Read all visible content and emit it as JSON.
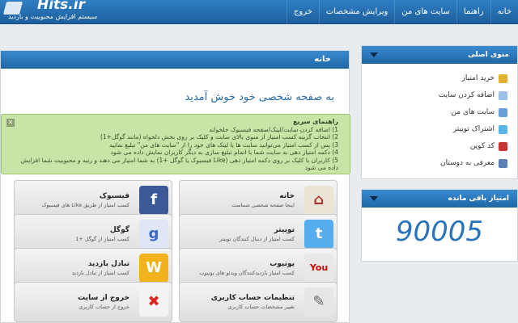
{
  "brand": {
    "logo_text": "Hits.ir",
    "tagline": "سیستم افزایش محبوبیت و بازدید"
  },
  "topnav": [
    "خانه",
    "راهنما",
    "سایت های من",
    "ویرایش مشخصات",
    "خروج"
  ],
  "main": {
    "header": "خانه",
    "welcome": "به صفحه شخصی خود خوش آمدید",
    "quick_guide": {
      "title": "راهنمای سریع",
      "lines": [
        "1) اضافه کردن سایت/لینک/صفحه فیسبوک خلخوانه",
        "2) انتخاب گزینه کسب امتیاز از منوی بالای سایت و کلیک بر روی بخش دلخواه (مانند گوگل+1)",
        "3) پس از کسب امتیاز می‌توانید سایت ها یا لینک های خود را از \"سایت های من\" تبلیغ نمایید",
        "4) دکمه امتیاز دهی به سایت شما با اتمام تبلیغ سازی به دیگر کاربران نمایش داده می شود",
        "5) کاربران با کلیک بر روی دکمه امتیاز دهی (Like فیسبوک یا گوگل +1) به شما امتیاز می دهند و رتبه و محبوبیت شما افزایش داده می شود"
      ]
    },
    "tiles": [
      {
        "title": "خانه",
        "subtitle": "اینجا صفحه شخصی شماست",
        "icon": "house-icon",
        "color": "#e9e4d5"
      },
      {
        "title": "فیسبوک",
        "subtitle": "کسب امتیاز از طریق Like های فیسبوک",
        "icon": "facebook-icon",
        "color": "#3b5998"
      },
      {
        "title": "توییتر",
        "subtitle": "کسب امتیاز از دنبال کنندگان توییتر",
        "icon": "twitter-icon",
        "color": "#55acee"
      },
      {
        "title": "گوگل",
        "subtitle": "کسب امتیاز از گوگل +1",
        "icon": "google-icon",
        "color": "#dfe6f5"
      },
      {
        "title": "یوتیوب",
        "subtitle": "کسب امتیاز بازدیدکنندگان ویدئو های یوتیوب",
        "icon": "youtube-icon",
        "color": "#e8e8e8"
      },
      {
        "title": "تبادل بازدید",
        "subtitle": "کسب امتیاز از تبادل بازدید",
        "icon": "hits-w-icon",
        "color": "#f2b21b"
      },
      {
        "title": "تنظیمات حساب کاربری",
        "subtitle": "تغییر مشخصات حساب کاربری",
        "icon": "wrench-icon",
        "color": "#e6e6e6"
      },
      {
        "title": "خروج از سایت",
        "subtitle": "خروج از حساب کاربری",
        "icon": "exit-icon",
        "color": "#f3f3f3"
      }
    ]
  },
  "sidebar": {
    "menu_title": "منوی اصلی",
    "menu_items": [
      {
        "label": "خرید امتیاز",
        "icon": "coins-icon",
        "color": "#e0b030"
      },
      {
        "label": "اضافه کردن سایت",
        "icon": "document-icon",
        "color": "#9cc0e6"
      },
      {
        "label": "سایت های من",
        "icon": "sites-icon",
        "color": "#6aa0d8"
      },
      {
        "label": "اشتراک توییتر",
        "icon": "twitter-small-icon",
        "color": "#5ab4e8"
      },
      {
        "label": "کد کوپن",
        "icon": "coupon-icon",
        "color": "#c33"
      },
      {
        "label": "معرفی به دوستان",
        "icon": "user-icon",
        "color": "#5a7fb0"
      }
    ],
    "points_title": "امتیاز باقی مانده",
    "points_value": "90005"
  }
}
